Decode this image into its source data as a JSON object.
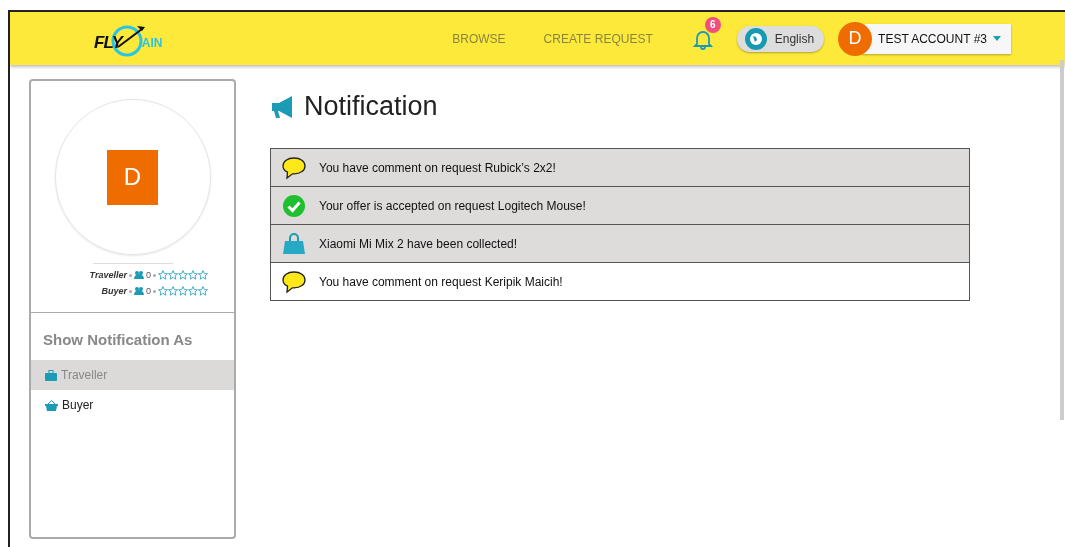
{
  "header": {
    "logo": {
      "left": "FLY",
      "right": "AIN"
    },
    "nav": [
      {
        "label": "BROWSE"
      },
      {
        "label": "CREATE REQUEST"
      }
    ],
    "notifications_badge": "6",
    "language": "English",
    "account": {
      "initial": "D",
      "name": "TEST ACCOUNT #3"
    }
  },
  "profile": {
    "initial": "D",
    "ratings": [
      {
        "label": "Traveller",
        "count": "0",
        "stars": 0
      },
      {
        "label": "Buyer",
        "count": "0",
        "stars": 0
      }
    ]
  },
  "sidebar": {
    "title": "Show Notification As",
    "items": [
      {
        "kind": "traveller",
        "label": "Traveller",
        "selected": true
      },
      {
        "kind": "buyer",
        "label": "Buyer",
        "selected": false
      }
    ]
  },
  "page_title": "Notification",
  "notifications": [
    {
      "kind": "comment",
      "text": "You have comment on request Rubick’s 2x2!",
      "unread": true
    },
    {
      "kind": "accepted",
      "text": "Your offer is accepted on request Logitech Mouse!",
      "unread": true
    },
    {
      "kind": "collected",
      "text": "Xiaomi Mi Mix 2 have been collected!",
      "unread": true
    },
    {
      "kind": "comment",
      "text": "You have comment on request Keripik Maicih!",
      "unread": false
    }
  ]
}
